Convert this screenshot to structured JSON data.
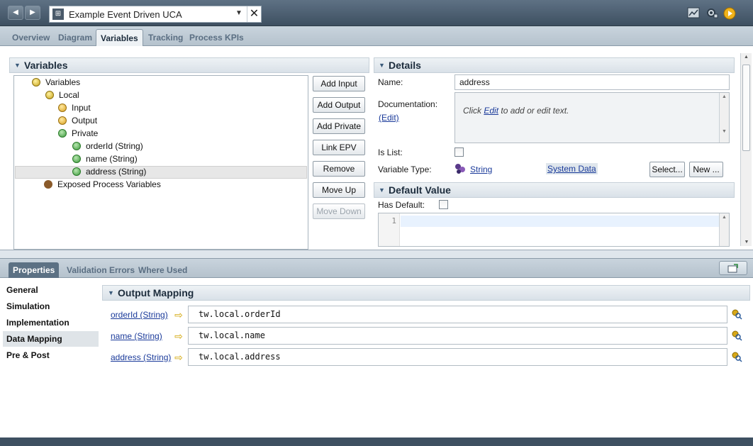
{
  "window": {
    "title": "Example Event Driven UCA",
    "back_label": "◀",
    "forward_label": "▶",
    "dropdown_glyph": "▼",
    "close_glyph": "✕"
  },
  "editor_tabs": [
    "Overview",
    "Diagram",
    "Variables",
    "Tracking",
    "Process KPIs"
  ],
  "active_editor_tab": "Variables",
  "variables_panel": {
    "header": "Variables",
    "tree": {
      "root": "Variables",
      "local": "Local",
      "input": "Input",
      "output": "Output",
      "private": "Private",
      "private_items": [
        "orderId (String)",
        "name (String)",
        "address (String)"
      ],
      "selected_item": "address (String)",
      "exposed": "Exposed Process Variables"
    },
    "buttons": {
      "add_input": "Add Input",
      "add_output": "Add Output",
      "add_private": "Add Private",
      "link_epv": "Link EPV",
      "remove": "Remove",
      "move_up": "Move Up",
      "move_down": "Move Down"
    }
  },
  "details_panel": {
    "header": "Details",
    "name_label": "Name:",
    "name_value": "address",
    "documentation_label": "Documentation:",
    "edit_link": "(Edit)",
    "doc_text_before": "Click ",
    "doc_text_link": "Edit",
    "doc_text_after": " to add or edit text.",
    "is_list_label": "Is List:",
    "is_list_checked": false,
    "variable_type_label": "Variable Type:",
    "variable_type_value": "String",
    "toolkit_value": "System Data",
    "select_button": "Select...",
    "new_button": "New ...",
    "default_value_header": "Default Value",
    "has_default_label": "Has Default:",
    "has_default_checked": false,
    "line_number": "1"
  },
  "bottom_tabs": [
    "Properties",
    "Validation Errors",
    "Where Used"
  ],
  "active_bottom_tab": "Properties",
  "properties_nav": [
    "General",
    "Simulation",
    "Implementation",
    "Data Mapping",
    "Pre & Post"
  ],
  "active_properties_nav": "Data Mapping",
  "output_mapping": {
    "header": "Output Mapping",
    "rows": [
      {
        "variable": "orderId (String)",
        "expression": "tw.local.orderId"
      },
      {
        "variable": "name (String)",
        "expression": "tw.local.name"
      },
      {
        "variable": "address (String)",
        "expression": "tw.local.address"
      }
    ]
  },
  "icons": {
    "back": "back-arrow-icon",
    "forward": "forward-arrow-icon",
    "process": "process-app-icon",
    "chart": "chart-icon",
    "settings": "settings-icon",
    "run": "run-icon",
    "maximize": "maximize-icon"
  },
  "colors": {
    "titlebar": "#4a5c6e",
    "tab_active": "#eef2f5",
    "accent_link": "#1a3a9a",
    "mapping_arrow": "#d2a400"
  }
}
